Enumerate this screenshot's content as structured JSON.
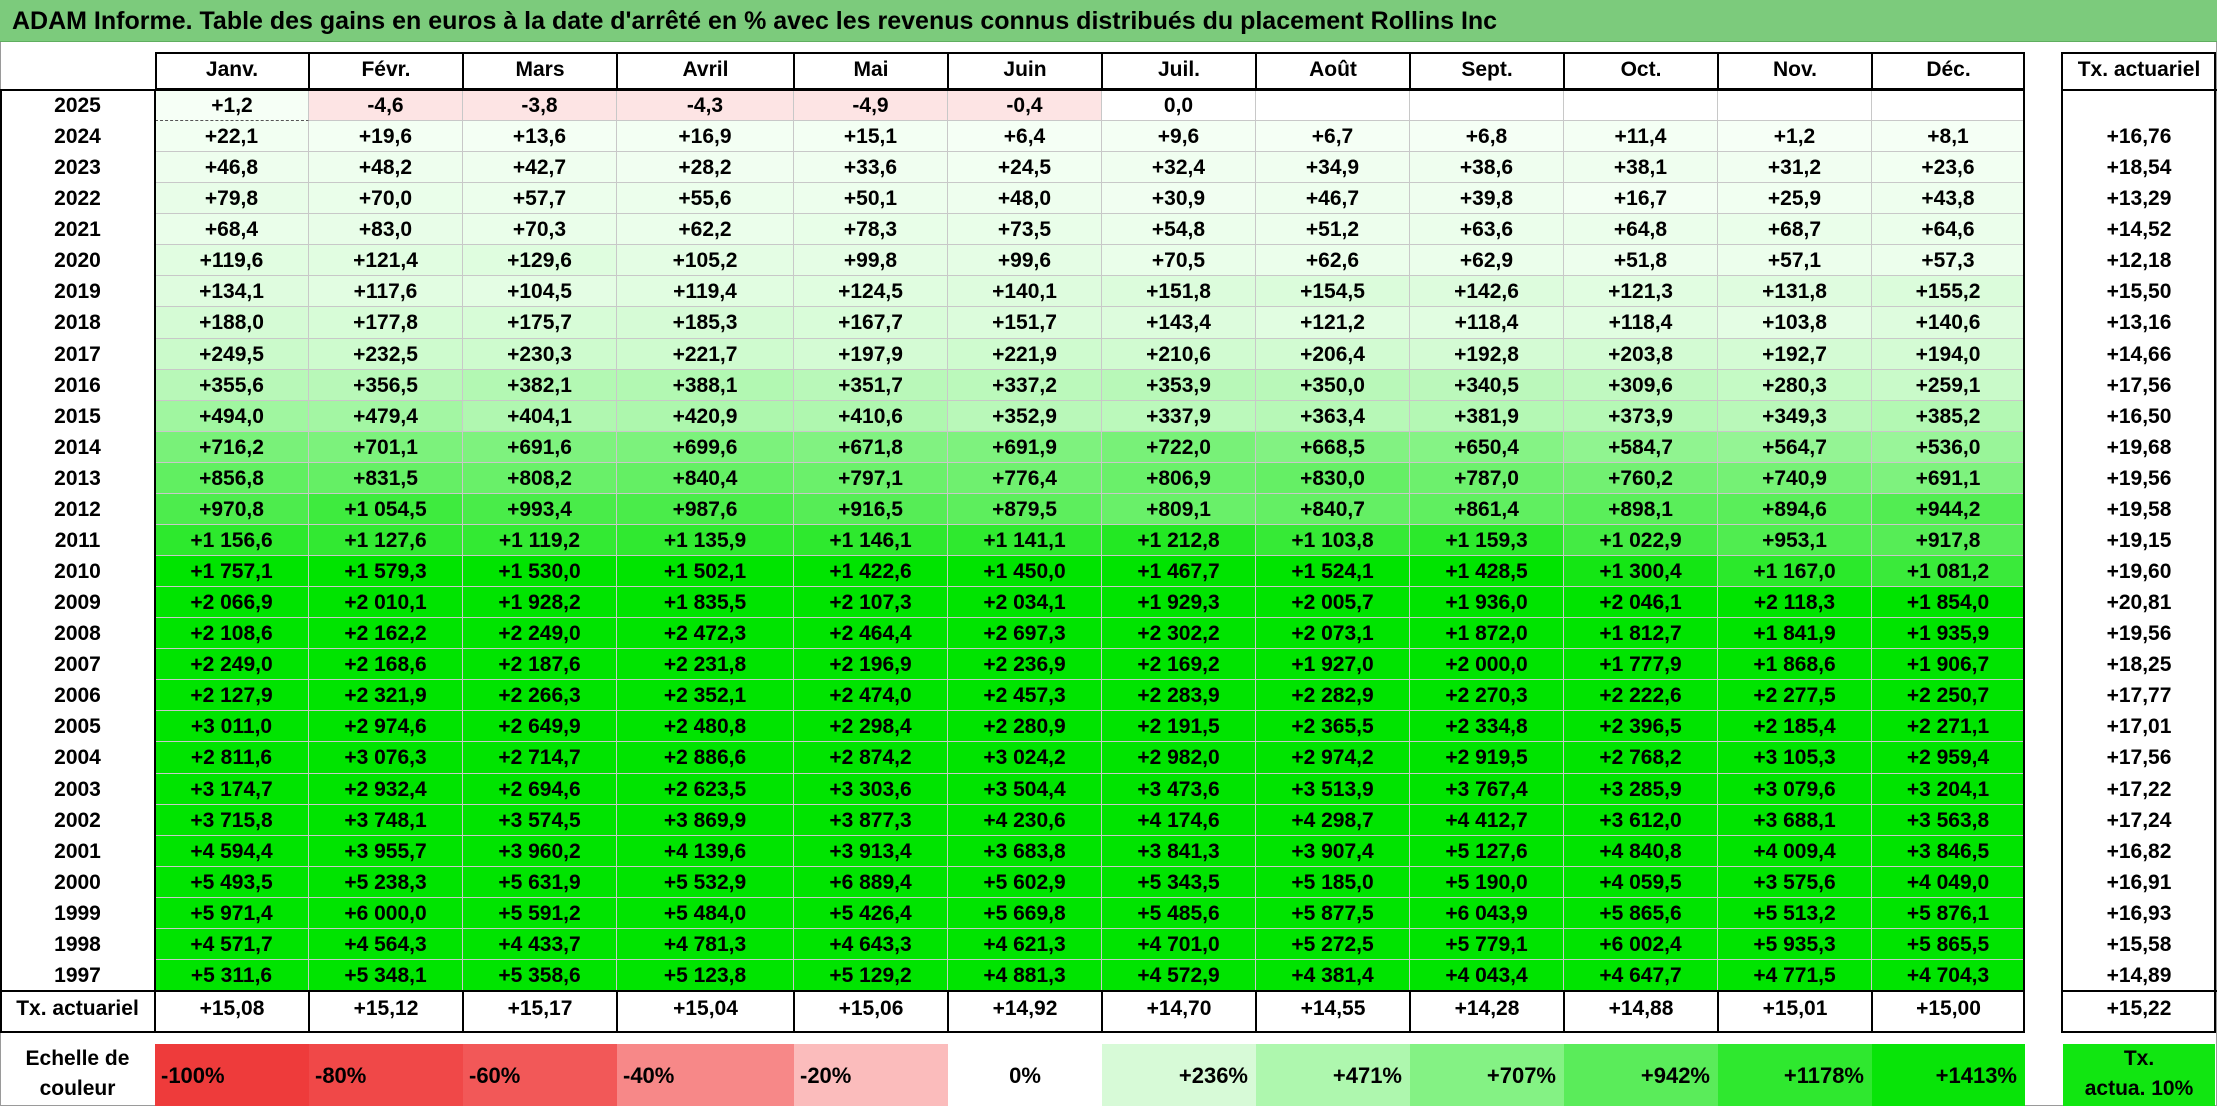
{
  "title": "ADAM Informe. Table des gains en euros à la date d'arrêté en % avec les revenus connus distribués du placement Rollins Inc",
  "months": [
    "Janv.",
    "Févr.",
    "Mars",
    "Avril",
    "Mai",
    "Juin",
    "Juil.",
    "Août",
    "Sept.",
    "Oct.",
    "Nov.",
    "Déc."
  ],
  "tx_header": "Tx. actuariel",
  "rows": [
    {
      "year": "2025",
      "values": [
        "+1,2",
        "-4,6",
        "-3,8",
        "-4,3",
        "-4,9",
        "-0,4",
        "0,0",
        "",
        "",
        "",
        "",
        ""
      ],
      "tx": ""
    },
    {
      "year": "2024",
      "values": [
        "+22,1",
        "+19,6",
        "+13,6",
        "+16,9",
        "+15,1",
        "+6,4",
        "+9,6",
        "+6,7",
        "+6,8",
        "+11,4",
        "+1,2",
        "+8,1"
      ],
      "tx": "+16,76"
    },
    {
      "year": "2023",
      "values": [
        "+46,8",
        "+48,2",
        "+42,7",
        "+28,2",
        "+33,6",
        "+24,5",
        "+32,4",
        "+34,9",
        "+38,6",
        "+38,1",
        "+31,2",
        "+23,6"
      ],
      "tx": "+18,54"
    },
    {
      "year": "2022",
      "values": [
        "+79,8",
        "+70,0",
        "+57,7",
        "+55,6",
        "+50,1",
        "+48,0",
        "+30,9",
        "+46,7",
        "+39,8",
        "+16,7",
        "+25,9",
        "+43,8"
      ],
      "tx": "+13,29"
    },
    {
      "year": "2021",
      "values": [
        "+68,4",
        "+83,0",
        "+70,3",
        "+62,2",
        "+78,3",
        "+73,5",
        "+54,8",
        "+51,2",
        "+63,6",
        "+64,8",
        "+68,7",
        "+64,6"
      ],
      "tx": "+14,52"
    },
    {
      "year": "2020",
      "values": [
        "+119,6",
        "+121,4",
        "+129,6",
        "+105,2",
        "+99,8",
        "+99,6",
        "+70,5",
        "+62,6",
        "+62,9",
        "+51,8",
        "+57,1",
        "+57,3"
      ],
      "tx": "+12,18"
    },
    {
      "year": "2019",
      "values": [
        "+134,1",
        "+117,6",
        "+104,5",
        "+119,4",
        "+124,5",
        "+140,1",
        "+151,8",
        "+154,5",
        "+142,6",
        "+121,3",
        "+131,8",
        "+155,2"
      ],
      "tx": "+15,50"
    },
    {
      "year": "2018",
      "values": [
        "+188,0",
        "+177,8",
        "+175,7",
        "+185,3",
        "+167,7",
        "+151,7",
        "+143,4",
        "+121,2",
        "+118,4",
        "+118,4",
        "+103,8",
        "+140,6"
      ],
      "tx": "+13,16"
    },
    {
      "year": "2017",
      "values": [
        "+249,5",
        "+232,5",
        "+230,3",
        "+221,7",
        "+197,9",
        "+221,9",
        "+210,6",
        "+206,4",
        "+192,8",
        "+203,8",
        "+192,7",
        "+194,0"
      ],
      "tx": "+14,66"
    },
    {
      "year": "2016",
      "values": [
        "+355,6",
        "+356,5",
        "+382,1",
        "+388,1",
        "+351,7",
        "+337,2",
        "+353,9",
        "+350,0",
        "+340,5",
        "+309,6",
        "+280,3",
        "+259,1"
      ],
      "tx": "+17,56"
    },
    {
      "year": "2015",
      "values": [
        "+494,0",
        "+479,4",
        "+404,1",
        "+420,9",
        "+410,6",
        "+352,9",
        "+337,9",
        "+363,4",
        "+381,9",
        "+373,9",
        "+349,3",
        "+385,2"
      ],
      "tx": "+16,50"
    },
    {
      "year": "2014",
      "values": [
        "+716,2",
        "+701,1",
        "+691,6",
        "+699,6",
        "+671,8",
        "+691,9",
        "+722,0",
        "+668,5",
        "+650,4",
        "+584,7",
        "+564,7",
        "+536,0"
      ],
      "tx": "+19,68"
    },
    {
      "year": "2013",
      "values": [
        "+856,8",
        "+831,5",
        "+808,2",
        "+840,4",
        "+797,1",
        "+776,4",
        "+806,9",
        "+830,0",
        "+787,0",
        "+760,2",
        "+740,9",
        "+691,1"
      ],
      "tx": "+19,56"
    },
    {
      "year": "2012",
      "values": [
        "+970,8",
        "+1 054,5",
        "+993,4",
        "+987,6",
        "+916,5",
        "+879,5",
        "+809,1",
        "+840,7",
        "+861,4",
        "+898,1",
        "+894,6",
        "+944,2"
      ],
      "tx": "+19,58"
    },
    {
      "year": "2011",
      "values": [
        "+1 156,6",
        "+1 127,6",
        "+1 119,2",
        "+1 135,9",
        "+1 146,1",
        "+1 141,1",
        "+1 212,8",
        "+1 103,8",
        "+1 159,3",
        "+1 022,9",
        "+953,1",
        "+917,8"
      ],
      "tx": "+19,15"
    },
    {
      "year": "2010",
      "values": [
        "+1 757,1",
        "+1 579,3",
        "+1 530,0",
        "+1 502,1",
        "+1 422,6",
        "+1 450,0",
        "+1 467,7",
        "+1 524,1",
        "+1 428,5",
        "+1 300,4",
        "+1 167,0",
        "+1 081,2"
      ],
      "tx": "+19,60"
    },
    {
      "year": "2009",
      "values": [
        "+2 066,9",
        "+2 010,1",
        "+1 928,2",
        "+1 835,5",
        "+2 107,3",
        "+2 034,1",
        "+1 929,3",
        "+2 005,7",
        "+1 936,0",
        "+2 046,1",
        "+2 118,3",
        "+1 854,0"
      ],
      "tx": "+20,81"
    },
    {
      "year": "2008",
      "values": [
        "+2 108,6",
        "+2 162,2",
        "+2 249,0",
        "+2 472,3",
        "+2 464,4",
        "+2 697,3",
        "+2 302,2",
        "+2 073,1",
        "+1 872,0",
        "+1 812,7",
        "+1 841,9",
        "+1 935,9"
      ],
      "tx": "+19,56"
    },
    {
      "year": "2007",
      "values": [
        "+2 249,0",
        "+2 168,6",
        "+2 187,6",
        "+2 231,8",
        "+2 196,9",
        "+2 236,9",
        "+2 169,2",
        "+1 927,0",
        "+2 000,0",
        "+1 777,9",
        "+1 868,6",
        "+1 906,7"
      ],
      "tx": "+18,25"
    },
    {
      "year": "2006",
      "values": [
        "+2 127,9",
        "+2 321,9",
        "+2 266,3",
        "+2 352,1",
        "+2 474,0",
        "+2 457,3",
        "+2 283,9",
        "+2 282,9",
        "+2 270,3",
        "+2 222,6",
        "+2 277,5",
        "+2 250,7"
      ],
      "tx": "+17,77"
    },
    {
      "year": "2005",
      "values": [
        "+3 011,0",
        "+2 974,6",
        "+2 649,9",
        "+2 480,8",
        "+2 298,4",
        "+2 280,9",
        "+2 191,5",
        "+2 365,5",
        "+2 334,8",
        "+2 396,5",
        "+2 185,4",
        "+2 271,1"
      ],
      "tx": "+17,01"
    },
    {
      "year": "2004",
      "values": [
        "+2 811,6",
        "+3 076,3",
        "+2 714,7",
        "+2 886,6",
        "+2 874,2",
        "+3 024,2",
        "+2 982,0",
        "+2 974,2",
        "+2 919,5",
        "+2 768,2",
        "+3 105,3",
        "+2 959,4"
      ],
      "tx": "+17,56"
    },
    {
      "year": "2003",
      "values": [
        "+3 174,7",
        "+2 932,4",
        "+2 694,6",
        "+2 623,5",
        "+3 303,6",
        "+3 504,4",
        "+3 473,6",
        "+3 513,9",
        "+3 767,4",
        "+3 285,9",
        "+3 079,6",
        "+3 204,1"
      ],
      "tx": "+17,22"
    },
    {
      "year": "2002",
      "values": [
        "+3 715,8",
        "+3 748,1",
        "+3 574,5",
        "+3 869,9",
        "+3 877,3",
        "+4 230,6",
        "+4 174,6",
        "+4 298,7",
        "+4 412,7",
        "+3 612,0",
        "+3 688,1",
        "+3 563,8"
      ],
      "tx": "+17,24"
    },
    {
      "year": "2001",
      "values": [
        "+4 594,4",
        "+3 955,7",
        "+3 960,2",
        "+4 139,6",
        "+3 913,4",
        "+3 683,8",
        "+3 841,3",
        "+3 907,4",
        "+5 127,6",
        "+4 840,8",
        "+4 009,4",
        "+3 846,5"
      ],
      "tx": "+16,82"
    },
    {
      "year": "2000",
      "values": [
        "+5 493,5",
        "+5 238,3",
        "+5 631,9",
        "+5 532,9",
        "+6 889,4",
        "+5 602,9",
        "+5 343,5",
        "+5 185,0",
        "+5 190,0",
        "+4 059,5",
        "+3 575,6",
        "+4 049,0"
      ],
      "tx": "+16,91"
    },
    {
      "year": "1999",
      "values": [
        "+5 971,4",
        "+6 000,0",
        "+5 591,2",
        "+5 484,0",
        "+5 426,4",
        "+5 669,8",
        "+5 485,6",
        "+5 877,5",
        "+6 043,9",
        "+5 865,6",
        "+5 513,2",
        "+5 876,1"
      ],
      "tx": "+16,93"
    },
    {
      "year": "1998",
      "values": [
        "+4 571,7",
        "+4 564,3",
        "+4 433,7",
        "+4 781,3",
        "+4 643,3",
        "+4 621,3",
        "+4 701,0",
        "+5 272,5",
        "+5 779,1",
        "+6 002,4",
        "+5 935,3",
        "+5 865,5"
      ],
      "tx": "+15,58"
    },
    {
      "year": "1997",
      "values": [
        "+5 311,6",
        "+5 348,1",
        "+5 358,6",
        "+5 123,8",
        "+5 129,2",
        "+4 881,3",
        "+4 572,9",
        "+4 381,4",
        "+4 043,4",
        "+4 647,7",
        "+4 771,5",
        "+4 704,3"
      ],
      "tx": "+14,89"
    }
  ],
  "footer": {
    "label": "Tx. actuariel",
    "values": [
      "+15,08",
      "+15,12",
      "+15,17",
      "+15,04",
      "+15,06",
      "+14,92",
      "+14,70",
      "+14,55",
      "+14,28",
      "+14,88",
      "+15,01",
      "+15,00"
    ],
    "tx": "+15,22"
  },
  "scale": {
    "label_line1": "Echelle de",
    "label_line2": "couleur",
    "items": [
      {
        "text": "-100%",
        "color": "#ee3b3b",
        "kind": "neg"
      },
      {
        "text": "-80%",
        "color": "#f04848",
        "kind": "neg"
      },
      {
        "text": "-60%",
        "color": "#f25858",
        "kind": "neg"
      },
      {
        "text": "-40%",
        "color": "#f78888",
        "kind": "neg"
      },
      {
        "text": "-20%",
        "color": "#fbbcbc",
        "kind": "neg"
      },
      {
        "text": "0%",
        "color": "#ffffff",
        "kind": "zero"
      },
      {
        "text": "+236%",
        "color": "#d7fad7",
        "kind": "pos"
      },
      {
        "text": "+471%",
        "color": "#aef7ae",
        "kind": "pos"
      },
      {
        "text": "+707%",
        "color": "#84f284",
        "kind": "pos"
      },
      {
        "text": "+942%",
        "color": "#5aec5a",
        "kind": "pos"
      },
      {
        "text": "+1178%",
        "color": "#2fe82f",
        "kind": "pos"
      },
      {
        "text": "+1413%",
        "color": "#08e408",
        "kind": "pos"
      }
    ],
    "tx_line1": "Tx.",
    "tx_line2": "actua. 10%",
    "tx_color": "#11e611"
  },
  "colors": {
    "title_bg": "#7ccb7c",
    "negative": "#fde4e4",
    "positive_max": "#00e000"
  }
}
